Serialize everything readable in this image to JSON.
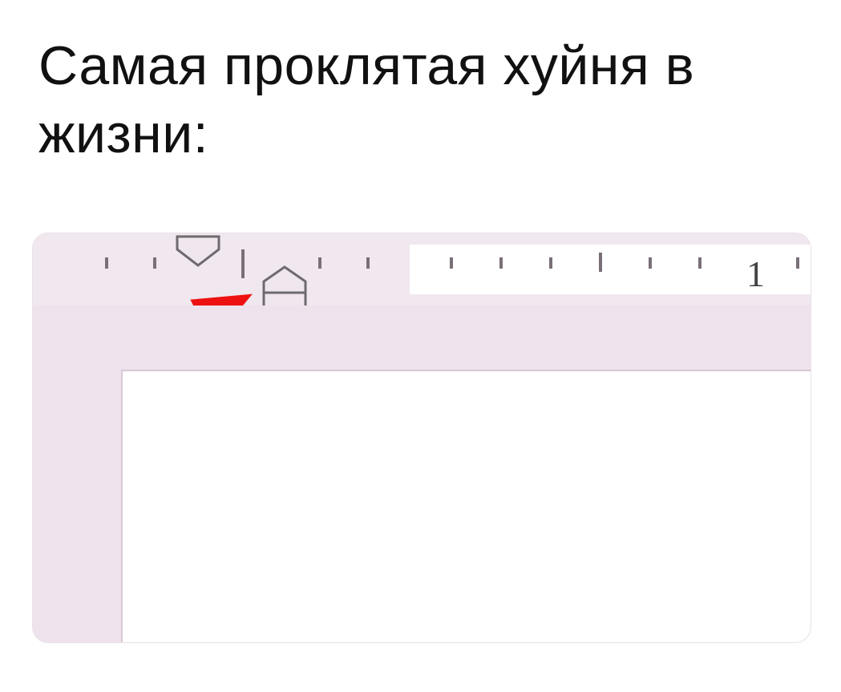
{
  "caption": "Самая проклятая хуйня в жизни:",
  "ruler": {
    "number_label": "1"
  }
}
